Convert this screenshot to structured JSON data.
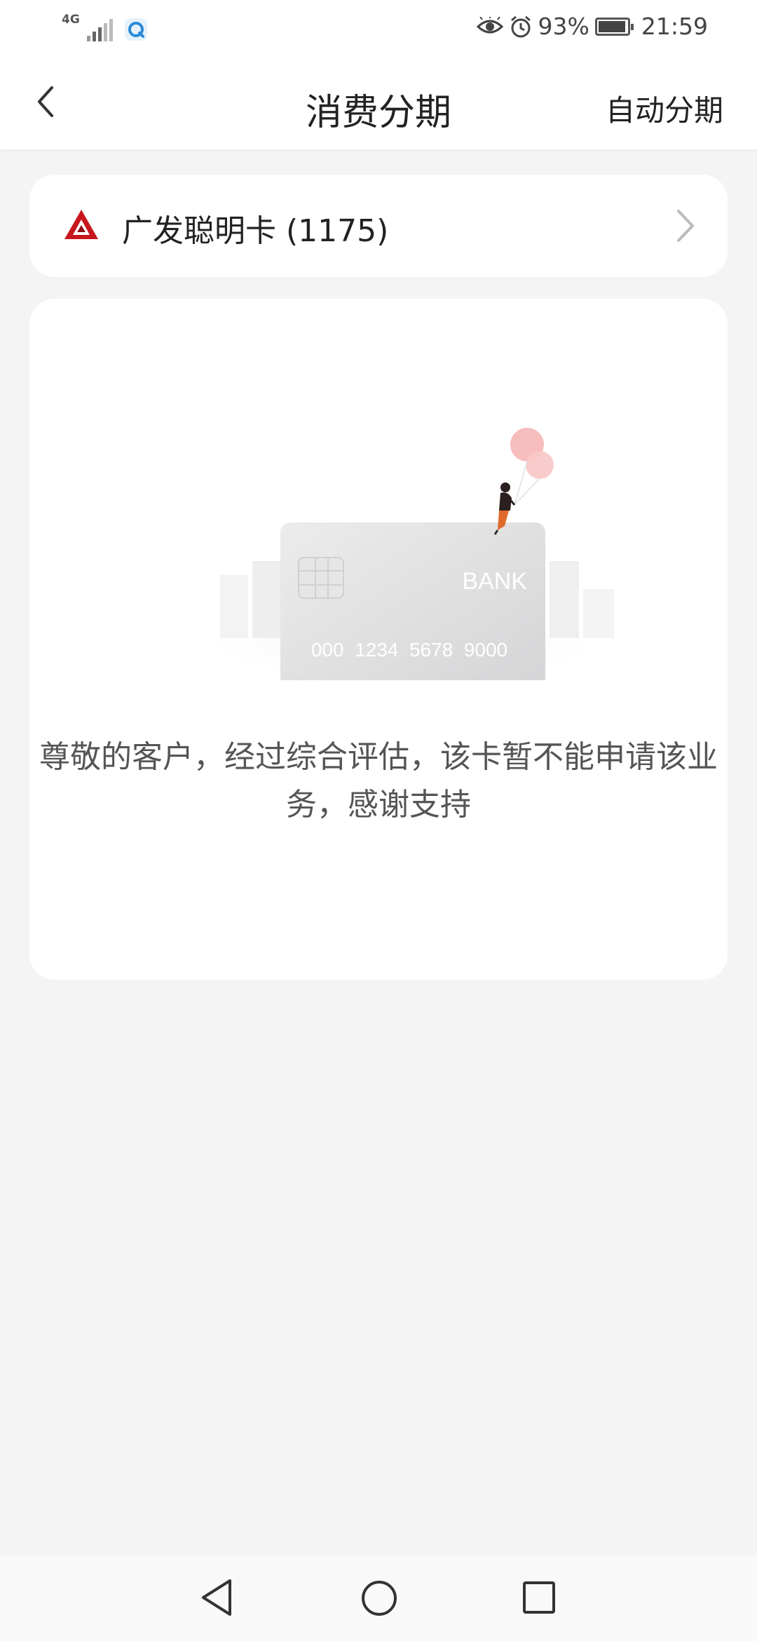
{
  "status_bar": {
    "network": "4G",
    "battery_percent": "93%",
    "time": "21:59",
    "icons": [
      "signal-icon",
      "app-notification-icon",
      "eye-comfort-icon",
      "alarm-icon",
      "battery-icon"
    ]
  },
  "header": {
    "title": "消费分期",
    "action_label": "自动分期",
    "back_icon": "chevron-left-icon"
  },
  "card_selector": {
    "card_label": "广发聪明卡 (1175)",
    "logo_icon": "bank-logo-icon",
    "arrow_icon": "chevron-right-icon"
  },
  "empty_state": {
    "illustration_bank_text": "BANK",
    "illustration_card_number": "000  1234  5678  9000",
    "message": "尊敬的客户，经过综合评估，该卡暂不能申请该业务，感谢支持"
  },
  "system_nav": {
    "icons": [
      "nav-back-icon",
      "nav-home-icon",
      "nav-recent-icon"
    ]
  },
  "colors": {
    "accent_red": "#c8161e",
    "background": "#f4f4f4",
    "card_background": "#ffffff"
  }
}
